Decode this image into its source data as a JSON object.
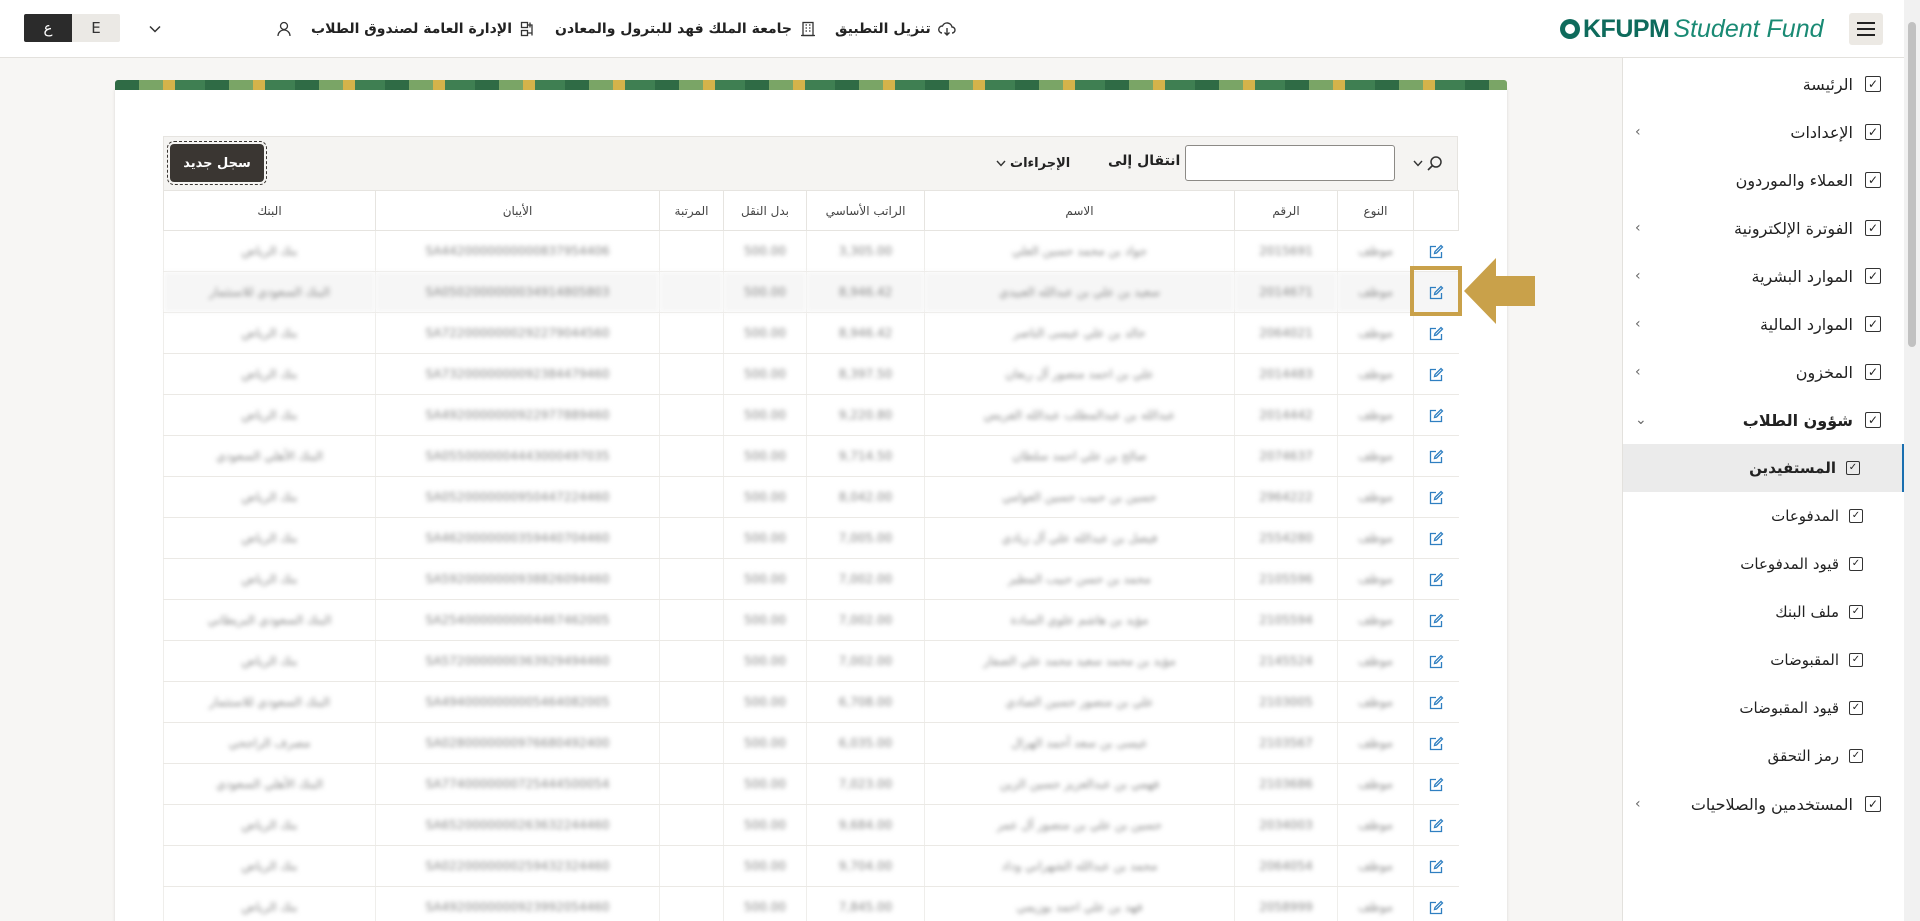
{
  "header": {
    "logo_bold": "KFUPM",
    "logo_light": "Student Fund",
    "links": [
      {
        "label": "تنزيل التطبيق",
        "icon": "cloud-download-icon"
      },
      {
        "label": "جامعة الملك فهد للبترول والمعادن",
        "icon": "building-icon"
      },
      {
        "label": "الإدارة العامة لصندوق الطلاب",
        "icon": "org-chart-icon"
      }
    ],
    "lang_ar": "ع",
    "lang_en": "E"
  },
  "sidebar": {
    "items": [
      {
        "label": "الرئيسة",
        "chevron": false
      },
      {
        "label": "الإعدادات",
        "chevron": true
      },
      {
        "label": "العملاء والموردون",
        "chevron": false
      },
      {
        "label": "الفوترة الإلكترونية",
        "chevron": true
      },
      {
        "label": "الموارد البشرية",
        "chevron": true
      },
      {
        "label": "الموارد المالية",
        "chevron": true
      },
      {
        "label": "المخزون",
        "chevron": true
      },
      {
        "label": "شؤون الطلاب",
        "chevron": "down"
      },
      {
        "label": "المستفيدين",
        "sub": true,
        "active": true
      },
      {
        "label": "المدفوعات",
        "sub": true
      },
      {
        "label": "قيود المدفوعات",
        "sub": true
      },
      {
        "label": "ملف البنك",
        "sub": true
      },
      {
        "label": "المقبوضات",
        "sub": true
      },
      {
        "label": "قيود المقبوضات",
        "sub": true
      },
      {
        "label": "رمز التحقق",
        "sub": true
      },
      {
        "label": "المستخدمين والصلاحيات",
        "chevron": true
      }
    ]
  },
  "toolbar": {
    "new_record": "سجل جديد",
    "actions": "الإجراءات",
    "goto": "انتقال إلى",
    "search_placeholder": ""
  },
  "table": {
    "columns": [
      "النوع",
      "الرقم",
      "الاسم",
      "الراتب الأساسي",
      "بدل النقل",
      "المرتبة",
      "الأيبان",
      "البنك"
    ],
    "rows": [
      [
        "موظف",
        "2015691",
        "جواد بن محمد حسين العلي",
        "3,305.00",
        "500.00",
        "",
        "SA4420000000000837954406",
        "بنك الرياض"
      ],
      [
        "موظف",
        "2014671",
        "سعيد بن علي بن عبدالله العبيدي",
        "8,946.42",
        "500.00",
        "",
        "SA0502000000034914805803",
        "البنك السعودي للاستثمار"
      ],
      [
        "موظف",
        "2064021",
        "خالد بن علي عيسى الناصر",
        "8,946.42",
        "500.00",
        "",
        "SA7220000000292279044560",
        "بنك الرياض"
      ],
      [
        "موظف",
        "2014483",
        "علي بن احمد منصور آل ربعان",
        "8,397.50",
        "500.00",
        "",
        "SA7320000000092384479460",
        "بنك الرياض"
      ],
      [
        "موظف",
        "2014442",
        "عبدالله بن عبدالمطلب عبدالله الفريس",
        "9,220.80",
        "500.00",
        "",
        "SA4920000000922977889460",
        "بنك الرياض"
      ],
      [
        "موظف",
        "2074637",
        "صالح بن علي احمد سلطان",
        "9,714.50",
        "500.00",
        "",
        "SA0550000004443000497035",
        "البنك الأهلي السعودي"
      ],
      [
        "موظف",
        "2964222",
        "حسين بن حبيب حسين العوامي",
        "8,042.00",
        "500.00",
        "",
        "SA0520000000950447224460",
        "بنك الرياض"
      ],
      [
        "موظف",
        "2554280",
        "فيصل بن عبدالله علي آل زيادي",
        "7,005.00",
        "500.00",
        "",
        "SA4620000000359440704460",
        "بنك الرياض"
      ],
      [
        "موظف",
        "2105596",
        "محمد بن حسن حبيب المطير",
        "7,002.00",
        "500.00",
        "",
        "SA5920000000938826094460",
        "بنك الرياض"
      ],
      [
        "موظف",
        "2105594",
        "مؤيد بن هاشم علوي السادة",
        "7,002.00",
        "500.00",
        "",
        "SA2540000000004467462005",
        "البنك السعودي البريطاني"
      ],
      [
        "موظف",
        "2145524",
        "مؤيد بن محمد سعيد محمد علي الصفار",
        "7,002.00",
        "500.00",
        "",
        "SA5720000000363929494460",
        "بنك الرياض"
      ],
      [
        "موظف",
        "2103005",
        "علي بن منصور حسين الصادي",
        "6,708.00",
        "500.00",
        "",
        "SA4940000000005464082005",
        "البنك السعودي للاستثمار"
      ],
      [
        "موظف",
        "2103567",
        "عيسى بن سعد أحمد الهزال",
        "6,035.00",
        "500.00",
        "",
        "SA0280000000976680492400",
        "مصرف الراجحي"
      ],
      [
        "موظف",
        "2103686",
        "فهمي بن عبدالعزيز حسين الزين",
        "7,023.00",
        "500.00",
        "",
        "SA7740000000725444500054",
        "البنك الأهلي السعودي"
      ],
      [
        "موظف",
        "2034003",
        "حسين بن علي بن منصور آل عمر",
        "9,684.00",
        "500.00",
        "",
        "SA6520000000263632244460",
        "بنك الرياض"
      ],
      [
        "موظف",
        "2064054",
        "محمد بن عبدالله الشهراني وداد",
        "9,704.00",
        "500.00",
        "",
        "SA0220000000259432324460",
        "بنك الرياض"
      ],
      [
        "موظف",
        "2058999",
        "فهد بن علي احمد بوزيمي",
        "7,845.00",
        "500.00",
        "",
        "SA4920000000923992054460",
        "بنك الرياض"
      ]
    ]
  },
  "colors": {
    "accent": "#c9a14a",
    "brand": "#0e6b5c",
    "primary_btn": "#3a3632"
  }
}
